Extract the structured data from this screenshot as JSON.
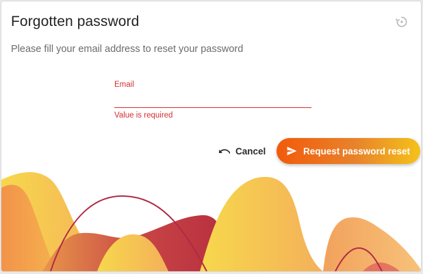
{
  "dialog": {
    "title": "Forgotten password",
    "subtitle": "Please fill your email address to reset your password"
  },
  "form": {
    "email": {
      "label": "Email",
      "value": "",
      "error": "Value is required"
    }
  },
  "actions": {
    "cancel_label": "Cancel",
    "submit_label": "Request password reset"
  },
  "icons": {
    "header": "history-icon",
    "cancel": "undo-icon",
    "submit": "send-icon"
  },
  "colors": {
    "error": "#d32f2f",
    "accent_start": "#f25a0a",
    "accent_end": "#f5c21a",
    "wave_line": "#b02a45"
  }
}
